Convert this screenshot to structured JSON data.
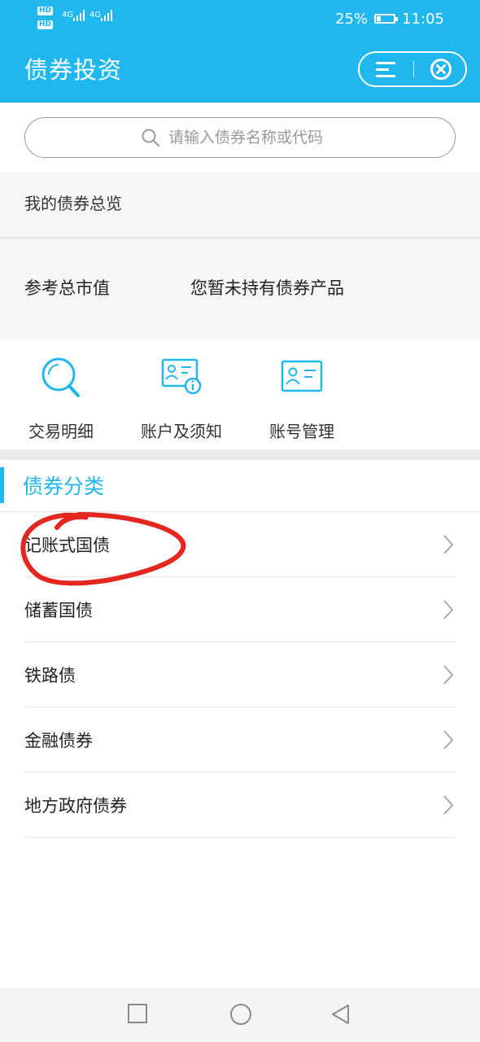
{
  "status_bar": {
    "hd_badge_1": "HD",
    "hd_badge_2": "HD",
    "signal_1": "4G",
    "signal_2": "4G",
    "battery_percent": "25%",
    "battery_level": 0.25,
    "time": "11:05"
  },
  "header": {
    "title": "债券投资",
    "menu_icon": "menu-icon",
    "close_icon": "close-circle-icon"
  },
  "search": {
    "placeholder": "请输入债券名称或代码",
    "value": ""
  },
  "overview": {
    "heading": "我的债券总览",
    "market_value_label": "参考总市值",
    "market_value_text": "您暂未持有债券产品"
  },
  "shortcuts": [
    {
      "label": "交易明细",
      "icon": "magnifier-icon"
    },
    {
      "label": "账户及须知",
      "icon": "account-info-icon"
    },
    {
      "label": "账号管理",
      "icon": "account-card-icon"
    }
  ],
  "section": {
    "title": "债券分类"
  },
  "categories": [
    {
      "label": "记账式国债"
    },
    {
      "label": "储蓄国债"
    },
    {
      "label": "铁路债"
    },
    {
      "label": "金融债券"
    },
    {
      "label": "地方政府债券"
    }
  ],
  "colors": {
    "brand": "#1fb7ee",
    "annotation": "#e4261f"
  },
  "nav": {
    "recent_icon": "square-icon",
    "home_icon": "circle-icon",
    "back_icon": "triangle-back-icon"
  }
}
